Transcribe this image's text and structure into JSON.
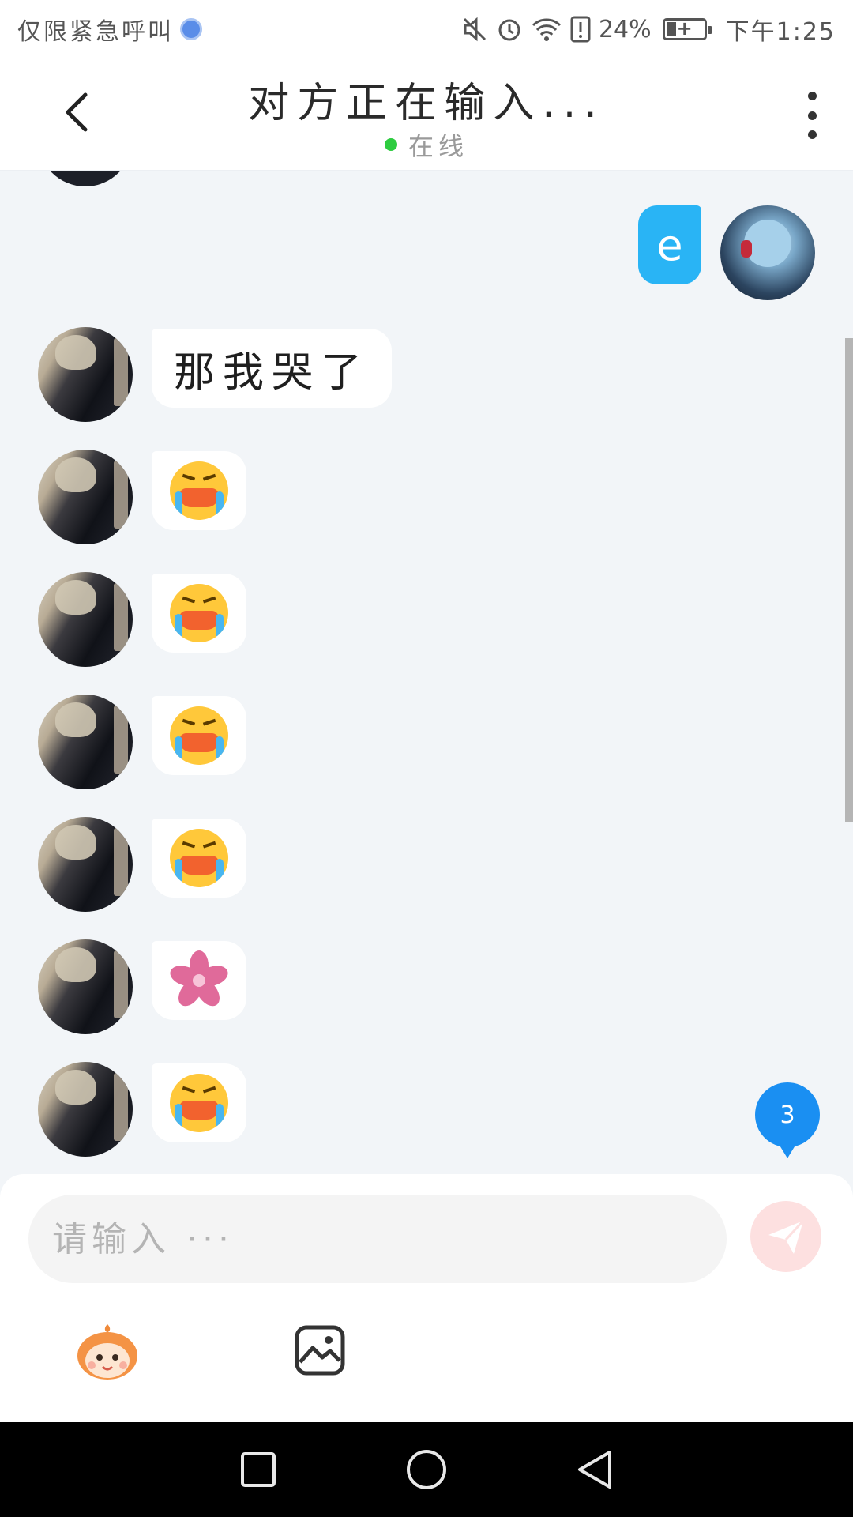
{
  "status_bar": {
    "carrier_text": "仅限紧急呼叫",
    "battery_percent": "24%",
    "time": "下午1:25",
    "icons": [
      "globe-icon",
      "mute-icon",
      "alarm-icon",
      "wifi-icon",
      "alert-icon",
      "battery-icon"
    ]
  },
  "header": {
    "title": "对方正在输入...",
    "status": "在线",
    "status_color": "#2ecc40"
  },
  "messages": [
    {
      "from": "me",
      "type": "text",
      "content": "e"
    },
    {
      "from": "them",
      "type": "text",
      "content": "那我哭了"
    },
    {
      "from": "them",
      "type": "emoji",
      "content": "crying-emoji"
    },
    {
      "from": "them",
      "type": "emoji",
      "content": "crying-emoji"
    },
    {
      "from": "them",
      "type": "emoji",
      "content": "crying-emoji"
    },
    {
      "from": "them",
      "type": "emoji",
      "content": "crying-emoji"
    },
    {
      "from": "them",
      "type": "emoji",
      "content": "sakura-emoji"
    },
    {
      "from": "them",
      "type": "emoji",
      "content": "crying-emoji"
    }
  ],
  "unread_badge": "3",
  "composer": {
    "placeholder": "请输入 ···",
    "value": "",
    "tools": [
      "emoji-mascot-icon",
      "image-icon"
    ]
  },
  "colors": {
    "accent_blue": "#29b4f5",
    "badge_blue": "#1a8ff2",
    "send_disabled": "#fde0e0"
  }
}
